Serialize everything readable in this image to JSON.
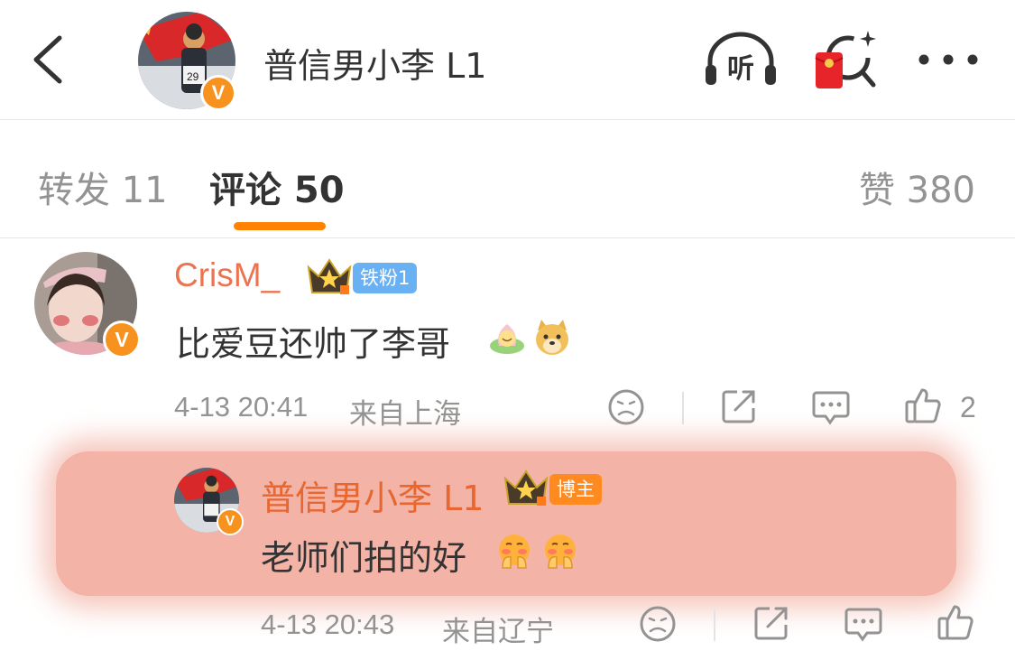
{
  "header": {
    "title": "普信男小李 L1",
    "avatar_badge": "V",
    "listen_label": "听"
  },
  "tabs": {
    "repost": "转发 11",
    "comments": "评论 50",
    "likes": "赞 380"
  },
  "comment": {
    "user": "CrisM_",
    "fan_badge": "铁粉1",
    "avatar_badge": "V",
    "text": "比爱豆还帅了李哥",
    "emojis": [
      "lotus-emoji",
      "doge-emoji"
    ],
    "time": "4-13 20:41",
    "location": "来自上海",
    "like_count": "2"
  },
  "reply": {
    "user": "普信男小李 L1",
    "owner_badge": "博主",
    "avatar_badge": "V",
    "text": "老师们拍的好",
    "emojis": [
      "blush-hands-emoji",
      "blush-hands-emoji"
    ],
    "time": "4-13 20:43",
    "location": "来自辽宁"
  },
  "colors": {
    "accent": "#ff8200",
    "username": "#eb7350",
    "vip_orange": "#f7921e",
    "highlight": "#f3b3a6",
    "fan_badge": "#6ab1f3"
  }
}
